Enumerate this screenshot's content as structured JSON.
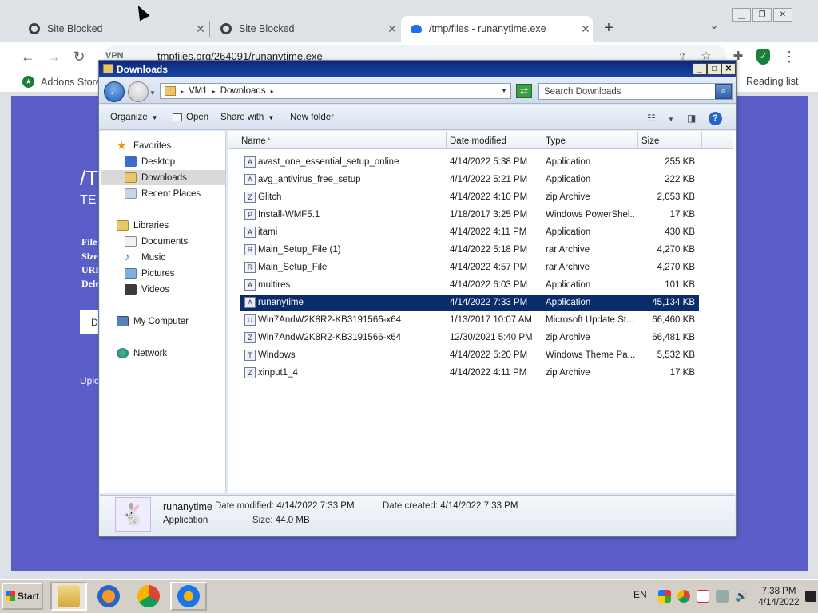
{
  "browser": {
    "tabs": [
      {
        "title": "Site Blocked",
        "active": false
      },
      {
        "title": "Site Blocked",
        "active": false
      },
      {
        "title": "/tmp/files - runanytime.exe",
        "active": true
      }
    ],
    "vpn_label": "VPN",
    "url": "tmpfiles.org/264091/runanytime.exe",
    "bookmarks": {
      "addons": "Addons Store",
      "reading_list": "Reading list"
    },
    "page": {
      "title": "/T",
      "subtitle": "TE",
      "box_letter": "D",
      "left_labels": [
        "File",
        "Size",
        "URL",
        "Dele"
      ],
      "upload": "Uplo"
    }
  },
  "explorer": {
    "title": "Downloads",
    "crumbs": [
      "VM1",
      "Downloads"
    ],
    "search_placeholder": "Search Downloads",
    "commands": {
      "organize": "Organize",
      "open": "Open",
      "share": "Share with",
      "new_folder": "New folder"
    },
    "nav": {
      "favorites": "Favorites",
      "desktop": "Desktop",
      "downloads": "Downloads",
      "recent": "Recent Places",
      "libraries": "Libraries",
      "documents": "Documents",
      "music": "Music",
      "pictures": "Pictures",
      "videos": "Videos",
      "computer": "My Computer",
      "network": "Network"
    },
    "columns": {
      "name": "Name",
      "date": "Date modified",
      "type": "Type",
      "size": "Size"
    },
    "files": [
      {
        "name": "avast_one_essential_setup_online",
        "date": "4/14/2022 5:38 PM",
        "type": "Application",
        "size": "255 KB",
        "icon": "A"
      },
      {
        "name": "avg_antivirus_free_setup",
        "date": "4/14/2022 5:21 PM",
        "type": "Application",
        "size": "222 KB",
        "icon": "A"
      },
      {
        "name": "Glitch",
        "date": "4/14/2022 4:10 PM",
        "type": "zip Archive",
        "size": "2,053 KB",
        "icon": "Z"
      },
      {
        "name": "Install-WMF5.1",
        "date": "1/18/2017 3:25 PM",
        "type": "Windows PowerShel...",
        "size": "17 KB",
        "icon": "P"
      },
      {
        "name": "itami",
        "date": "4/14/2022 4:11 PM",
        "type": "Application",
        "size": "430 KB",
        "icon": "A"
      },
      {
        "name": "Main_Setup_File (1)",
        "date": "4/14/2022 5:18 PM",
        "type": "rar Archive",
        "size": "4,270 KB",
        "icon": "R"
      },
      {
        "name": "Main_Setup_File",
        "date": "4/14/2022 4:57 PM",
        "type": "rar Archive",
        "size": "4,270 KB",
        "icon": "R"
      },
      {
        "name": "multires",
        "date": "4/14/2022 6:03 PM",
        "type": "Application",
        "size": "101 KB",
        "icon": "A"
      },
      {
        "name": "runanytime",
        "date": "4/14/2022 7:33 PM",
        "type": "Application",
        "size": "45,134 KB",
        "icon": "A",
        "selected": true
      },
      {
        "name": "Win7AndW2K8R2-KB3191566-x64",
        "date": "1/13/2017 10:07 AM",
        "type": "Microsoft Update St...",
        "size": "66,460 KB",
        "icon": "U"
      },
      {
        "name": "Win7AndW2K8R2-KB3191566-x64",
        "date": "12/30/2021 5:40 PM",
        "type": "zip Archive",
        "size": "66,481 KB",
        "icon": "Z"
      },
      {
        "name": "Windows",
        "date": "4/14/2022 5:20 PM",
        "type": "Windows Theme Pa...",
        "size": "5,532 KB",
        "icon": "T"
      },
      {
        "name": "xinput1_4",
        "date": "4/14/2022 4:11 PM",
        "type": "zip Archive",
        "size": "17 KB",
        "icon": "Z"
      }
    ],
    "details": {
      "name": "runanytime",
      "kind": "Application",
      "modified_label": "Date modified:",
      "modified": "4/14/2022 7:33 PM",
      "created_label": "Date created:",
      "created": "4/14/2022 7:33 PM",
      "size_label": "Size:",
      "size": "44.0 MB"
    }
  },
  "taskbar": {
    "start": "Start",
    "lang": "EN",
    "time": "7:38 PM",
    "date": "4/14/2022"
  },
  "colors": {
    "selection": "#0b2c6b",
    "page_bg": "#5b5ec8",
    "titlebar": "#0b287a"
  }
}
